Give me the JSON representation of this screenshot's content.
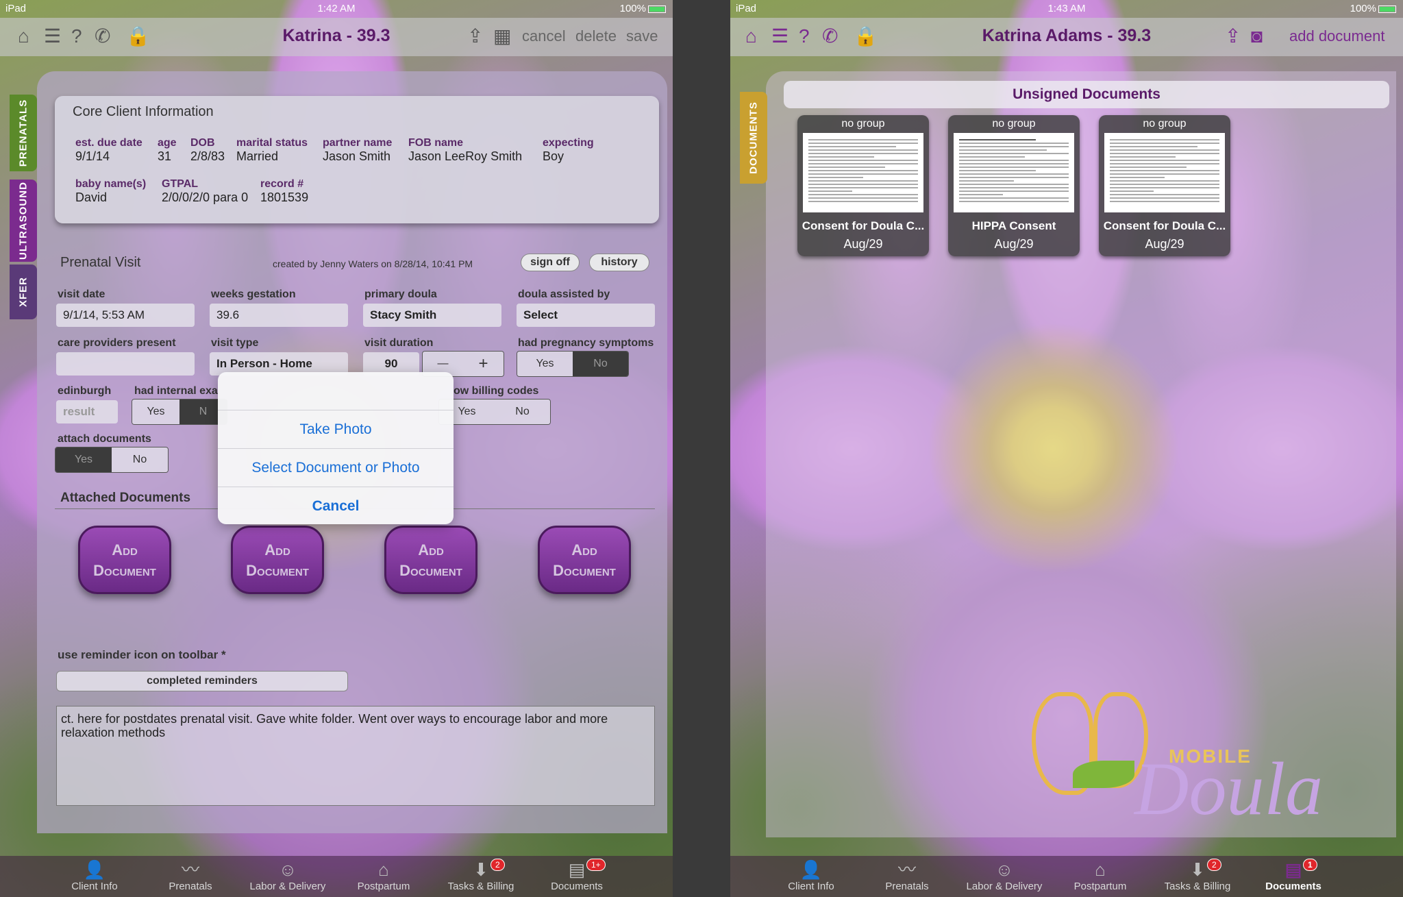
{
  "left": {
    "status": {
      "device": "iPad",
      "time": "1:42 AM",
      "battery": "100%"
    },
    "nav": {
      "title": "Katrina - 39.3",
      "cancel": "cancel",
      "delete": "delete",
      "save": "save"
    },
    "sidetabs": [
      "PRENATALS",
      "ULTRASOUND",
      "XFER"
    ],
    "core": {
      "title": "Core Client Information",
      "fields": [
        {
          "label": "est. due date",
          "value": "9/1/14"
        },
        {
          "label": "age",
          "value": "31"
        },
        {
          "label": "DOB",
          "value": "2/8/83"
        },
        {
          "label": "marital status",
          "value": "Married"
        },
        {
          "label": "partner name",
          "value": "Jason Smith"
        },
        {
          "label": "FOB name",
          "value": "Jason LeeRoy Smith"
        },
        {
          "label": "expecting",
          "value": "Boy"
        },
        {
          "label": "baby name(s)",
          "value": "David"
        },
        {
          "label": "GTPAL",
          "value": "2/0/0/2/0 para 0"
        },
        {
          "label": "record #",
          "value": "1801539"
        }
      ]
    },
    "visit": {
      "title": "Prenatal Visit",
      "created": "created by Jenny Waters on 8/28/14, 10:41 PM",
      "sign_off": "sign off",
      "history": "history",
      "visit_date_label": "visit date",
      "visit_date": "9/1/14, 5:53 AM",
      "weeks_label": "weeks gestation",
      "weeks": "39.6",
      "doula_label": "primary doula",
      "doula": "Stacy Smith",
      "assist_label": "doula assisted by",
      "assist": "Select",
      "care_label": "care providers present",
      "type_label": "visit type",
      "type": "In Person - Home",
      "duration_label": "visit duration",
      "duration": "90",
      "minus": "—",
      "plus": "+",
      "symptoms_label": "had pregnancy symptoms",
      "yes": "Yes",
      "no": "No",
      "edinburgh_label": "edinburgh",
      "edinburgh_placeholder": "result",
      "internal_label": "had internal exa",
      "internal_no_partial": "N",
      "billing_label": "ow billing codes",
      "attach_label": "attach documents",
      "attached_title": "Attached Documents",
      "add_document": [
        "Add Document",
        "Add Document",
        "Add Document",
        "Add Document"
      ],
      "reminder_label": "use reminder icon on toolbar *",
      "completed_reminders": "completed reminders",
      "notes": "ct. here for postdates prenatal visit.  Gave white folder.  Went over ways to encourage labor and more relaxation methods"
    },
    "sheet": {
      "take_photo": "Take Photo",
      "select": "Select Document or Photo",
      "cancel": "Cancel"
    },
    "tabs": [
      {
        "label": "Client Info"
      },
      {
        "label": "Prenatals"
      },
      {
        "label": "Labor & Delivery"
      },
      {
        "label": "Postpartum"
      },
      {
        "label": "Tasks & Billing",
        "badge": "2"
      },
      {
        "label": "Documents",
        "badge": "1+"
      }
    ]
  },
  "right": {
    "status": {
      "device": "iPad",
      "time": "1:43 AM",
      "battery": "100%"
    },
    "nav": {
      "title": "Katrina Adams - 39.3",
      "add_document": "add document"
    },
    "sidetab": "DOCUMENTS",
    "section_title": "Unsigned Documents",
    "docs": [
      {
        "group": "no group",
        "title": "Consent for Doula C...",
        "date": "Aug/29"
      },
      {
        "group": "no group",
        "title": "HIPPA Consent",
        "date": "Aug/29"
      },
      {
        "group": "no group",
        "title": "Consent for Doula C...",
        "date": "Aug/29"
      }
    ],
    "logo": {
      "mobile": "MOBILE",
      "doula": "Doula"
    },
    "tabs": [
      {
        "label": "Client Info"
      },
      {
        "label": "Prenatals"
      },
      {
        "label": "Labor & Delivery"
      },
      {
        "label": "Postpartum"
      },
      {
        "label": "Tasks & Billing",
        "badge": "2"
      },
      {
        "label": "Documents",
        "badge": "1"
      }
    ]
  },
  "colors": {
    "brand_purple": "#7a2a90",
    "ios_blue": "#1a6fd6",
    "tab_prenatals": "#5b8a2a",
    "tab_ultrasound": "#7b2b8e",
    "tab_xfer": "#5a3a78",
    "tab_documents": "#c9a030"
  }
}
